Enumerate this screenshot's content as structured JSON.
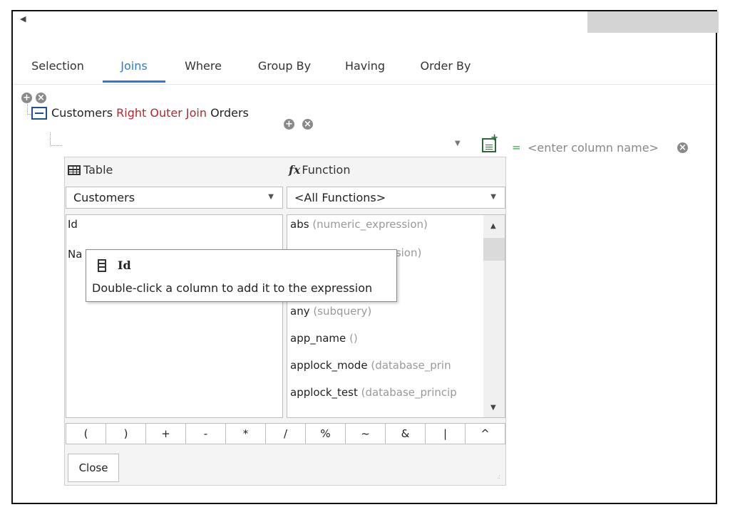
{
  "topbar": {
    "back_icon": "triangle-left-icon"
  },
  "tabs": [
    {
      "label": "Selection",
      "active": false
    },
    {
      "label": "Joins",
      "active": true
    },
    {
      "label": "Where",
      "active": false
    },
    {
      "label": "Group By",
      "active": false
    },
    {
      "label": "Having",
      "active": false
    },
    {
      "label": "Order By",
      "active": false
    }
  ],
  "join": {
    "left_table": "Customers",
    "join_type": "Right Outer Join",
    "right_table": "Orders"
  },
  "condition": {
    "equals": "=",
    "column_placeholder": "<enter column name>"
  },
  "panel": {
    "table_header": "Table",
    "function_header": "Function",
    "table_select": "Customers",
    "function_select": "<All Functions>",
    "columns": [
      "Id",
      "Na"
    ],
    "functions": [
      {
        "name": "abs",
        "args": "(numeric_expression)"
      },
      {
        "name": "",
        "args": "ssion)"
      },
      {
        "name": "any",
        "args": "(subquery)"
      },
      {
        "name": "app_name",
        "args": "()"
      },
      {
        "name": "applock_mode",
        "args": "(database_prin"
      },
      {
        "name": "applock_test",
        "args": "(database_princip"
      }
    ],
    "operators": [
      "(",
      ")",
      "+",
      "-",
      "*",
      "/",
      "%",
      "~",
      "&",
      "|",
      "^"
    ],
    "close_label": "Close"
  },
  "tooltip": {
    "title": "Id",
    "text": "Double-click a column to add it to the expression"
  },
  "colors": {
    "accent": "#2b7bd6",
    "join_type": "#b5262a",
    "equals": "#3aa64a"
  }
}
